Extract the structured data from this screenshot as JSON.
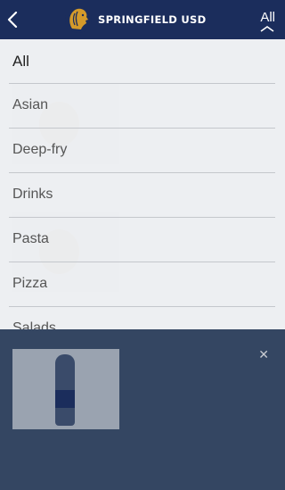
{
  "header": {
    "brand": "SPRINGFIELD USD",
    "filter_label": "All"
  },
  "menu": {
    "items": [
      {
        "label": "All",
        "selected": true
      },
      {
        "label": "Asian",
        "selected": false
      },
      {
        "label": "Deep-fry",
        "selected": false
      },
      {
        "label": "Drinks",
        "selected": false
      },
      {
        "label": "Pasta",
        "selected": false
      },
      {
        "label": "Pizza",
        "selected": false
      },
      {
        "label": "Salads",
        "selected": false
      }
    ]
  },
  "colors": {
    "header_bg": "#1b2d5c",
    "logo_gold": "#d49a2a",
    "overlay": "#182c4c"
  },
  "icons": [
    "chevron-left-icon",
    "lion-logo-icon",
    "chevron-up-icon",
    "close-icon"
  ]
}
